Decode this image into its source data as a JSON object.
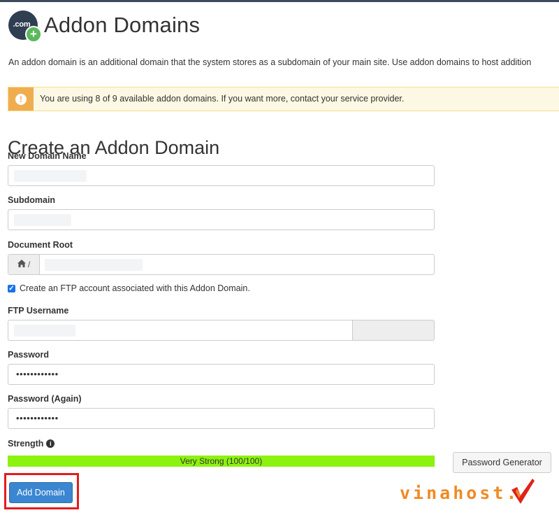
{
  "header": {
    "logo_text": ".com",
    "title": "Addon Domains"
  },
  "description": "An addon domain is an additional domain that the system stores as a subdomain of your main site. Use addon domains to host addition",
  "alert": {
    "text": "You are using 8 of 9 available addon domains. If you want more, contact your service provider."
  },
  "form": {
    "section_title": "Create an Addon Domain",
    "new_domain_label": "New Domain Name",
    "subdomain_label": "Subdomain",
    "document_root_label": "Document Root",
    "document_root_prefix": "/",
    "ftp_checkbox_label": "Create an FTP account associated with this Addon Domain.",
    "ftp_checked": true,
    "ftp_username_label": "FTP Username",
    "password_label": "Password",
    "password_value": "••••••••••••",
    "password_again_label": "Password (Again)",
    "password_again_value": "••••••••••••",
    "strength_label": "Strength",
    "strength_text": "Very Strong (100/100)",
    "strength_percent": 100,
    "password_generator_label": "Password Generator",
    "submit_label": "Add Domain"
  },
  "colors": {
    "strength_fill": "#8cf20f",
    "alert_accent": "#f0ad4e",
    "primary_button": "#3a86d1",
    "highlight_border": "#e41c1c"
  },
  "watermark": {
    "text": "vinahost."
  },
  "icons": {
    "alert": "exclamation-circle-icon",
    "home": "home-icon",
    "info": "info-circle-icon",
    "check": "checkmark-icon"
  }
}
